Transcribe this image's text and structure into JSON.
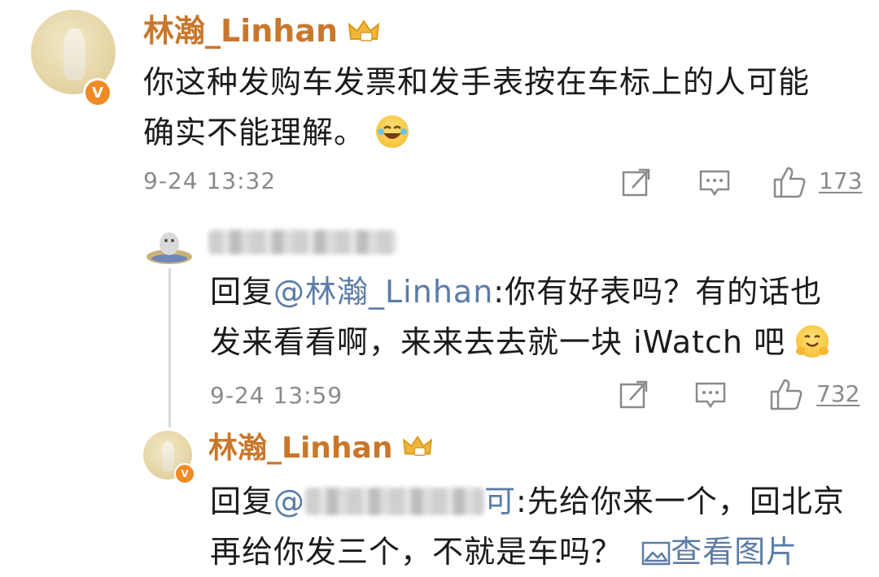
{
  "comment1": {
    "username": "林瀚_Linhan",
    "verified_badge": "V",
    "text_lines": [
      "你这种发购车发票和发手表按在车标上的人可能",
      "确实不能理解。"
    ],
    "emoji": "laughing-tears-emoji",
    "timestamp": "9-24 13:32",
    "like_count": "173"
  },
  "reply1": {
    "username_blurred": true,
    "prefix": "回复",
    "mention": "@林瀚_Linhan",
    "text_lines": [
      ":你有好表吗？有的话也",
      "发来看看啊，来来去去就一块 iWatch 吧"
    ],
    "emoji": "hugging-face-emoji",
    "timestamp": "9-24 13:59",
    "like_count": "732"
  },
  "reply2": {
    "username": "林瀚_Linhan",
    "verified_badge": "V",
    "prefix": "回复",
    "mention_visible_part": "@",
    "mention_tail": "可",
    "text_lines": [
      ":先给你来一个，回北京",
      "再给你发三个，不就是车吗？"
    ],
    "view_image_label": "查看图片"
  },
  "colors": {
    "username": "#c9772c",
    "mention": "#5b7ca6",
    "meta_gray": "#8a8a8a",
    "badge": "#f08a24"
  }
}
